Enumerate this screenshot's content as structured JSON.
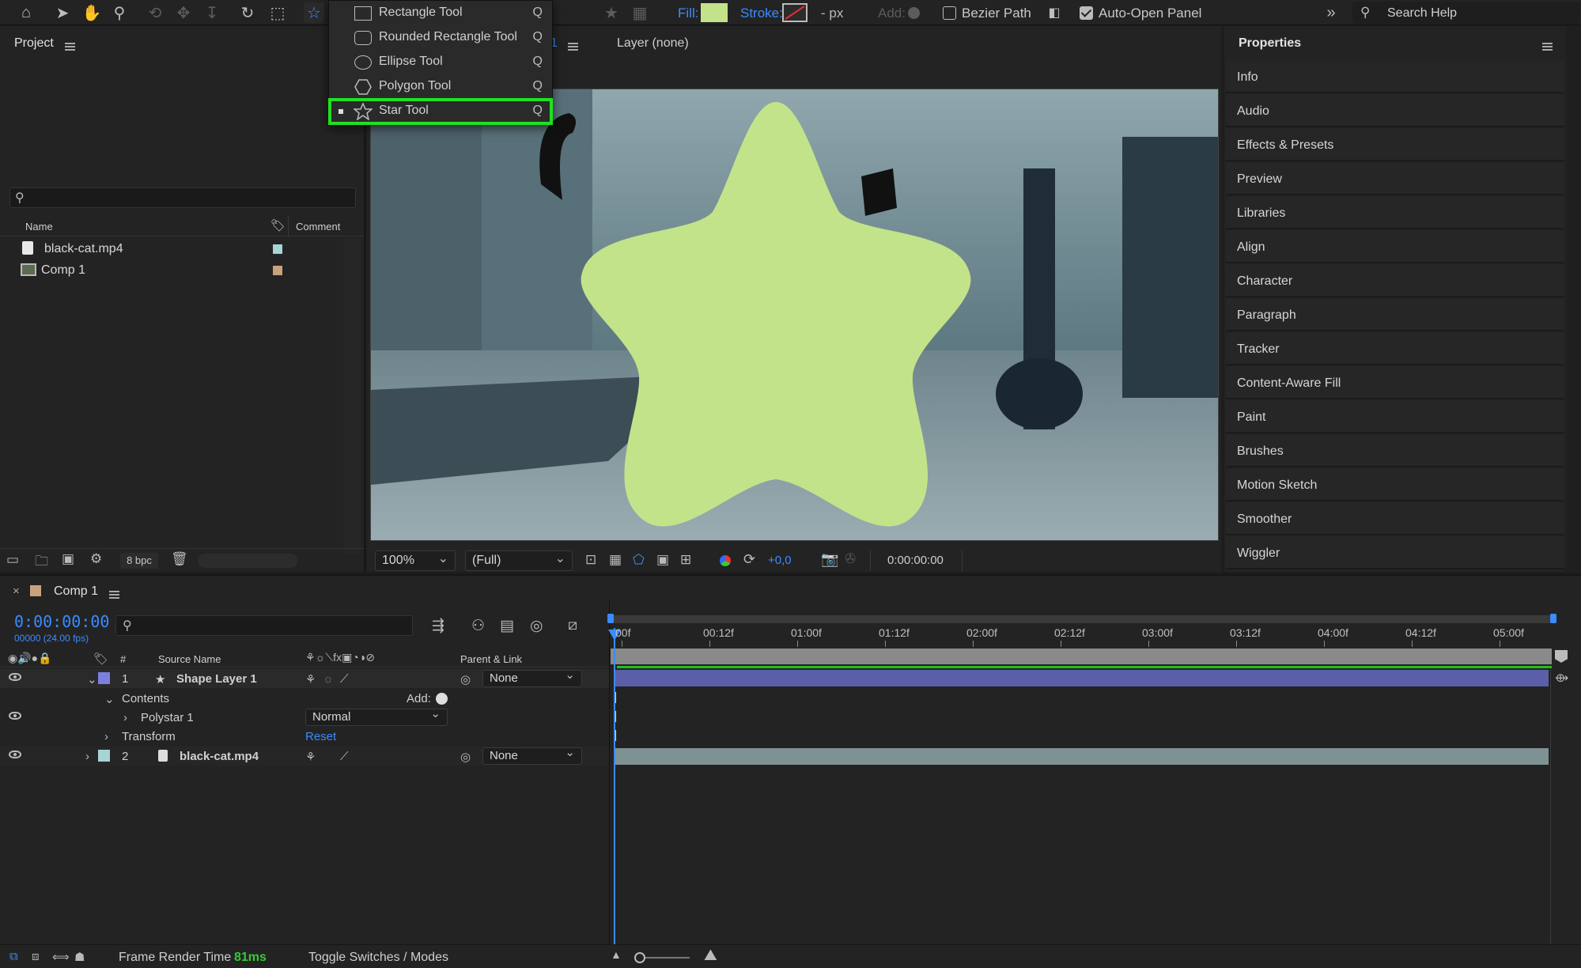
{
  "toolbar": {
    "fill_label": "Fill:",
    "fill_color": "#c3e38a",
    "stroke_label": "Stroke:",
    "stroke_width": "- px",
    "add_label": "Add:",
    "bezier_label": "Bezier Path",
    "auto_open_label": "Auto-Open Panel",
    "search_placeholder": "Search Help"
  },
  "tool_menu": {
    "items": [
      {
        "label": "Rectangle Tool",
        "key": "Q",
        "icon": "rectangle-icon"
      },
      {
        "label": "Rounded Rectangle Tool",
        "key": "Q",
        "icon": "rounded-rectangle-icon"
      },
      {
        "label": "Ellipse Tool",
        "key": "Q",
        "icon": "ellipse-icon"
      },
      {
        "label": "Polygon Tool",
        "key": "Q",
        "icon": "polygon-icon"
      },
      {
        "label": "Star Tool",
        "key": "Q",
        "icon": "star-icon"
      }
    ],
    "highlight_color": "#20e020"
  },
  "project": {
    "title": "Project",
    "col_name": "Name",
    "col_comment": "Comment",
    "items": [
      {
        "name": "black-cat.mp4",
        "label_color": "#a8d4d4"
      },
      {
        "name": "Comp 1",
        "label_color": "#c9a27c"
      }
    ],
    "bpc": "8 bpc"
  },
  "composition": {
    "tab_fragment": "1",
    "layer_tab": "Layer (none)",
    "zoom": "100%",
    "resolution": "(Full)",
    "exposure": "+0,0",
    "timecode": "0:00:00:00",
    "star_color": "#c3e38a"
  },
  "properties": {
    "title": "Properties",
    "items": [
      "Info",
      "Audio",
      "Effects & Presets",
      "Preview",
      "Libraries",
      "Align",
      "Character",
      "Paragraph",
      "Tracker",
      "Content-Aware Fill",
      "Paint",
      "Brushes",
      "Motion Sketch",
      "Smoother",
      "Wiggler"
    ]
  },
  "timeline": {
    "comp_tab": "Comp 1",
    "timecode": "0:00:00:00",
    "frame_info": "00000 (24.00 fps)",
    "col_source_name": "Source Name",
    "col_parent": "Parent & Link",
    "col_hash": "#",
    "ruler": [
      "00f",
      "00:12f",
      "01:00f",
      "01:12f",
      "02:00f",
      "02:12f",
      "03:00f",
      "03:12f",
      "04:00f",
      "04:12f",
      "05:00f"
    ],
    "layers": [
      {
        "num": "1",
        "name": "Shape Layer 1",
        "parent": "None",
        "color": "#7b80e0"
      },
      {
        "num": "2",
        "name": "black-cat.mp4",
        "parent": "None",
        "color": "#a8d4d4"
      }
    ],
    "contents_label": "Contents",
    "add_label": "Add:",
    "polystar_label": "Polystar 1",
    "blend_mode": "Normal",
    "transform_label": "Transform",
    "reset_label": "Reset"
  },
  "statusbar": {
    "render_label": "Frame Render Time",
    "render_value": "81ms",
    "toggle_label": "Toggle Switches / Modes"
  }
}
